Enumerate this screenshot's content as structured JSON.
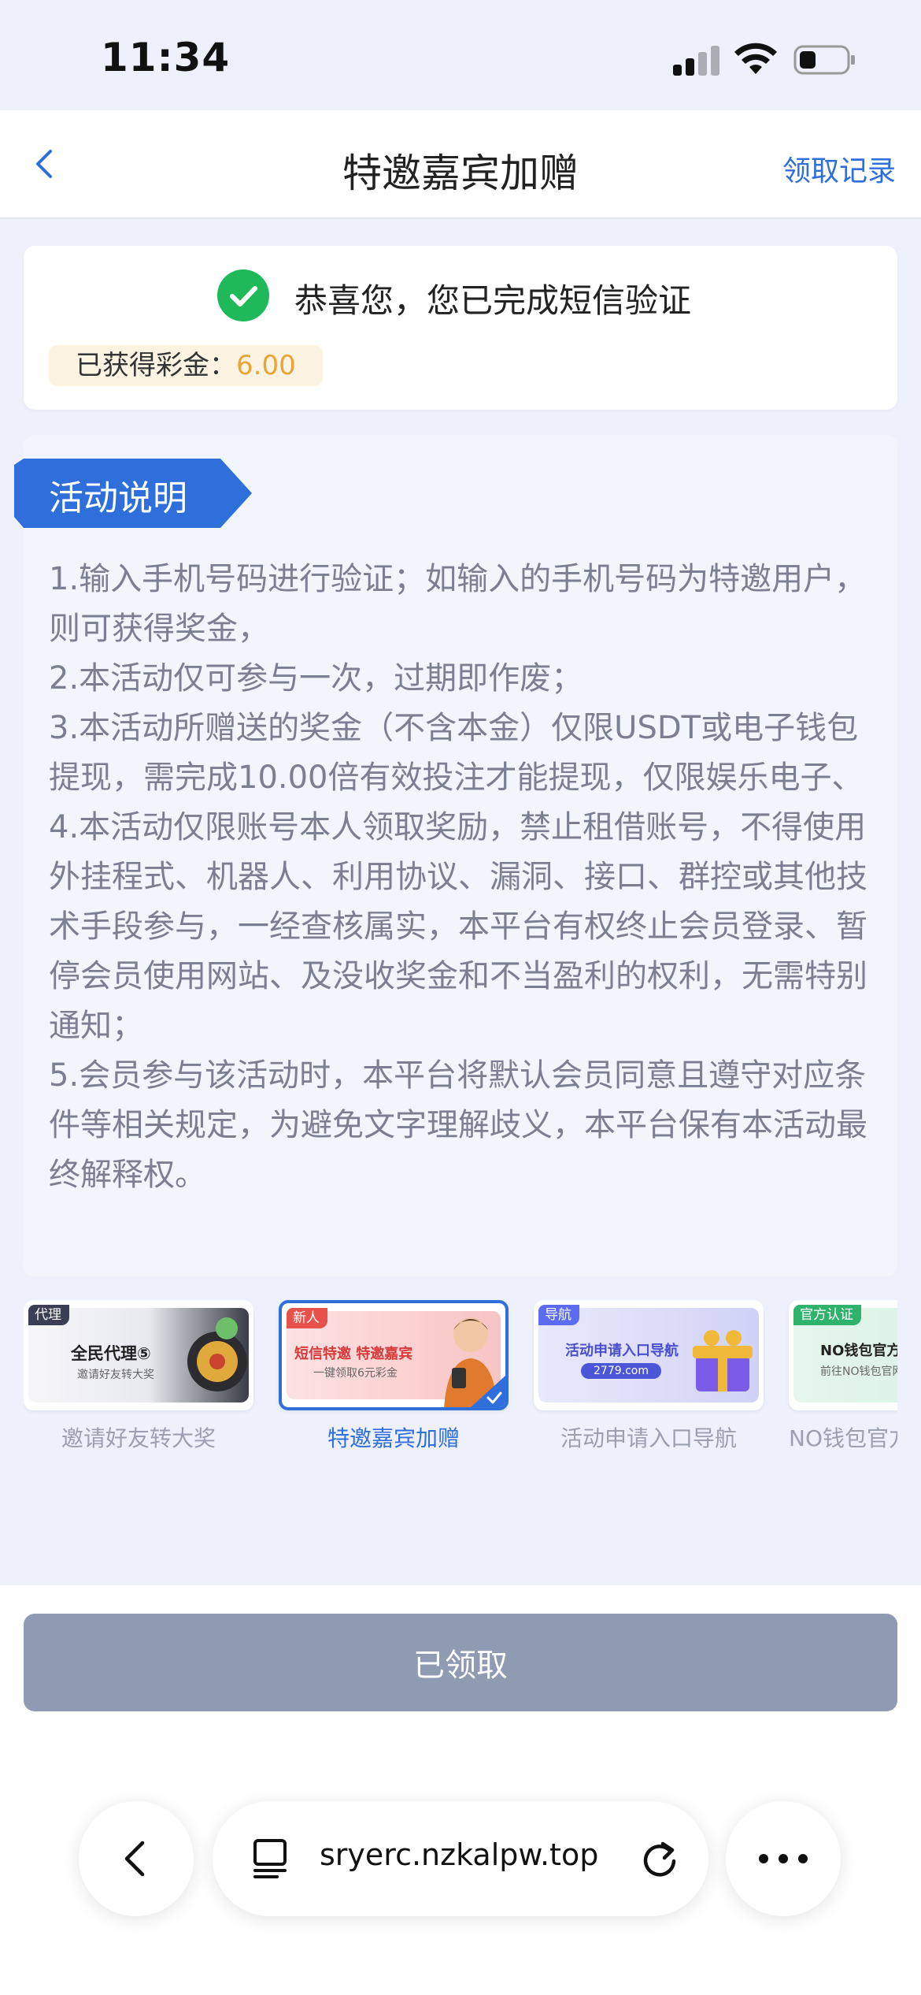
{
  "status_bar": {
    "time": "11:34"
  },
  "header": {
    "title": "特邀嘉宾加赠",
    "records_link": "领取记录"
  },
  "success": {
    "message": "恭喜您，您已完成短信验证",
    "bonus_label": "已获得彩金：",
    "bonus_value": "6.00"
  },
  "rules": {
    "tag": "活动说明",
    "lines": [
      "1.输入手机号码进行验证；如输入的手机号码为特邀用户，则可获得奖金，",
      "2.本活动仅可参与一次，过期即作废；",
      "3.本活动所赠送的奖金（不含本金）仅限USDT或电子钱包提现，需完成10.00倍有效投注才能提现，仅限娱乐电子、",
      "4.本活动仅限账号本人领取奖励，禁止租借账号，不得使用外挂程式、机器人、利用协议、漏洞、接口、群控或其他技术手段参与，一经查核属实，本平台有权终止会员登录、暂停会员使用网站、及没收奖金和不当盈利的权利，无需特别通知；",
      "5.会员参与该活动时，本平台将默认会员同意且遵守对应条件等相关规定，为避免文字理解歧义，本平台保有本活动最终解释权。"
    ]
  },
  "promos": [
    {
      "badge": "代理",
      "heading": "全民代理⑤",
      "sub": "邀请好友转大奖",
      "caption": "邀请好友转大奖",
      "accent": "#3a3f55"
    },
    {
      "badge": "新人",
      "heading": "短信特邀 特邀嘉宾",
      "sub": "一键领取6元彩金",
      "caption": "特邀嘉宾加赠",
      "accent": "#e8504a"
    },
    {
      "badge": "导航",
      "heading": "活动申请入口导航",
      "sub": "2779.com",
      "caption": "活动申请入口导航",
      "accent": "#5b6cf0"
    },
    {
      "badge": "官方认证",
      "heading": "NO钱包官方",
      "sub": "前往NO钱包官网",
      "caption": "NO钱包官方",
      "accent": "#2fb36a"
    }
  ],
  "claim_button": {
    "label": "已领取"
  },
  "browser": {
    "url": "sryerc.nzkalpw.top"
  },
  "colors": {
    "primary": "#2f6fdc",
    "success": "#1fb95a",
    "bonus": "#e8a435",
    "disabled_button": "#8f9bb3"
  }
}
